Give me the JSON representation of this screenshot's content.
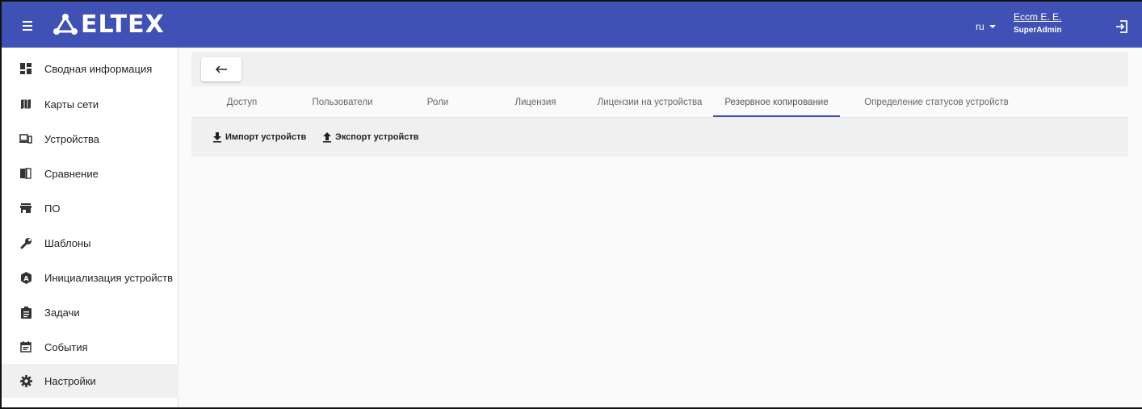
{
  "header": {
    "logo_text": "ELTEX",
    "language": "ru",
    "user_name": "Eccm E. E.",
    "user_role": "SuperAdmin",
    "brand_color": "#3f51b5"
  },
  "sidebar": {
    "items": [
      {
        "label": "Сводная информация",
        "icon": "dashboard-icon"
      },
      {
        "label": "Карты сети",
        "icon": "map-icon"
      },
      {
        "label": "Устройства",
        "icon": "devices-icon"
      },
      {
        "label": "Сравнение",
        "icon": "compare-icon"
      },
      {
        "label": "ПО",
        "icon": "store-icon"
      },
      {
        "label": "Шаблоны",
        "icon": "wrench-icon"
      },
      {
        "label": "Инициализация устройств",
        "icon": "init-icon"
      },
      {
        "label": "Задачи",
        "icon": "assignment-icon"
      },
      {
        "label": "События",
        "icon": "calendar-icon"
      },
      {
        "label": "Настройки",
        "icon": "gear-icon"
      }
    ],
    "active_index": 9
  },
  "main": {
    "back_icon": "arrow-left-icon",
    "tabs": [
      {
        "label": "Доступ"
      },
      {
        "label": "Пользователи"
      },
      {
        "label": "Роли"
      },
      {
        "label": "Лицензия"
      },
      {
        "label": "Лицензии на устройства"
      },
      {
        "label": "Резервное копирование"
      },
      {
        "label": "Определение статусов устройств"
      }
    ],
    "active_tab": 5,
    "actions": {
      "import_label": "Импорт устройств",
      "export_label": "Экспорт устройств"
    }
  }
}
